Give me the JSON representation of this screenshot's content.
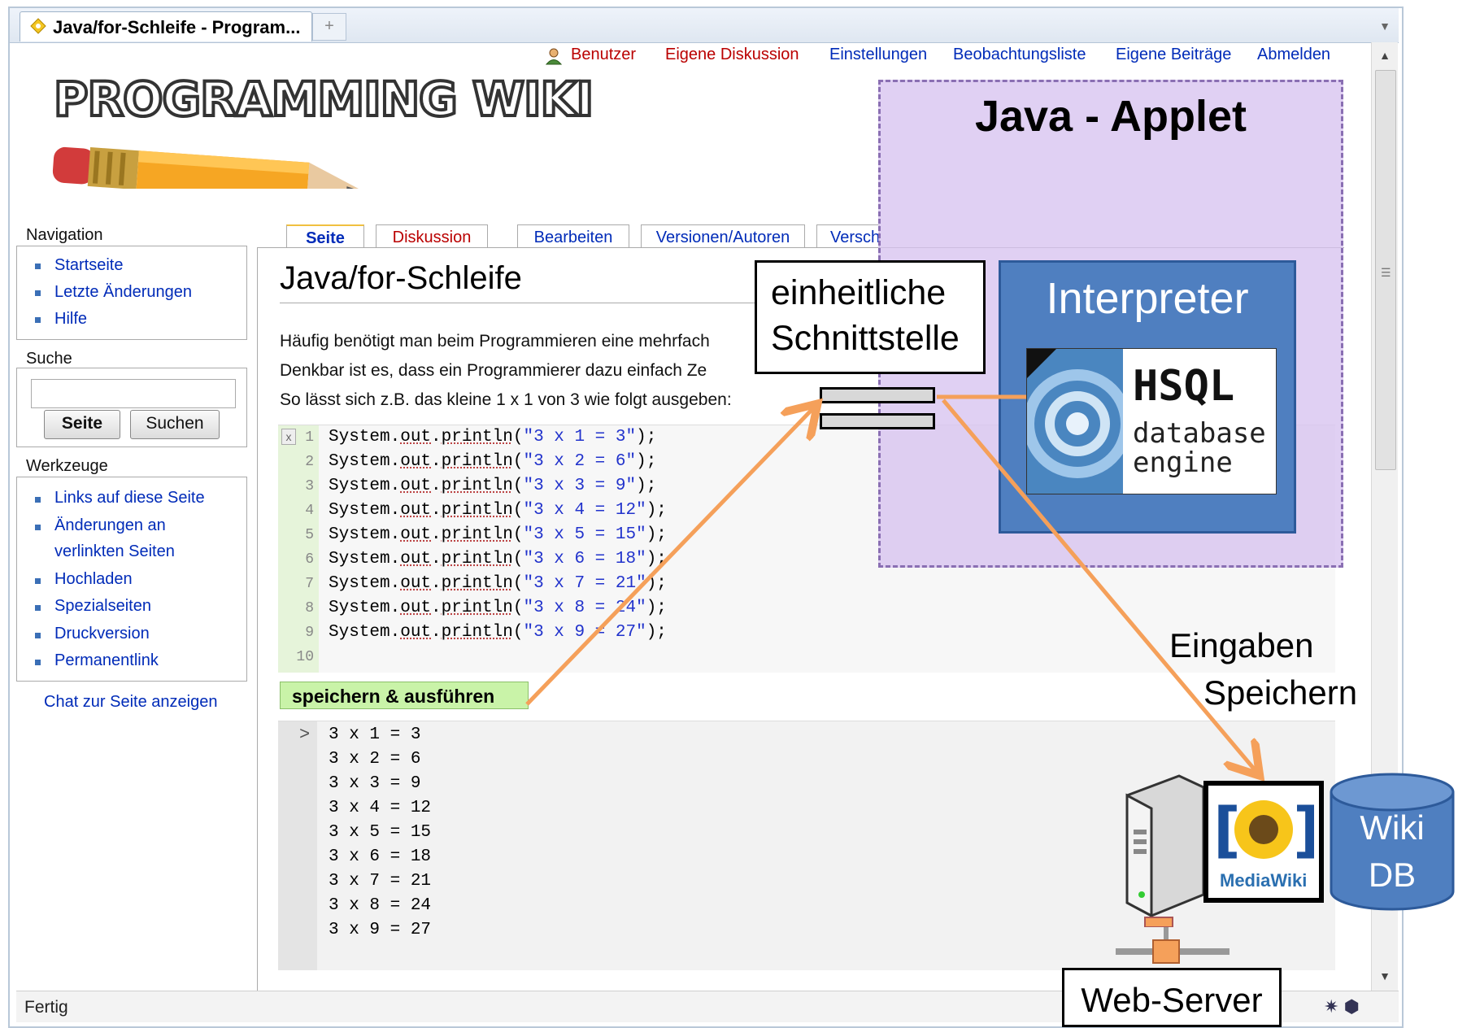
{
  "browser": {
    "tab_title": "Java/for-Schleife - Program...",
    "new_tab_icon": "plus-icon",
    "status_text": "Fertig"
  },
  "personal_links": {
    "user": "Benutzer",
    "own_discussion": "Eigene Diskussion",
    "settings": "Einstellungen",
    "watchlist": "Beobachtungsliste",
    "contributions": "Eigene Beiträge",
    "logout": "Abmelden"
  },
  "logo": {
    "text": "PROGRAMMING WIKI"
  },
  "navigation": {
    "heading": "Navigation",
    "items": [
      "Startseite",
      "Letzte Änderungen",
      "Hilfe"
    ]
  },
  "search": {
    "heading": "Suche",
    "value": "",
    "go_label": "Seite",
    "search_label": "Suchen"
  },
  "toolbox": {
    "heading": "Werkzeuge",
    "items": [
      "Links auf diese Seite",
      "Änderungen an",
      "verlinkten Seiten",
      "Hochladen",
      "Spezialseiten",
      "Druckversion",
      "Permanentlink"
    ],
    "chat_link": "Chat zur Seite anzeigen"
  },
  "content_tabs": [
    "Seite",
    "Diskussion",
    "Bearbeiten",
    "Versionen/Autoren",
    "Versch"
  ],
  "page": {
    "title": "Java/for-Schleife",
    "paragraphs": [
      "Häufig benötigt man beim Programmieren eine mehrfach",
      "Denkbar ist es, dass ein Programmierer dazu einfach Ze",
      "So lässt sich z.B. das kleine 1 x 1 von 3 wie folgt ausgeben:"
    ]
  },
  "editor": {
    "close_glyph": "x",
    "line_numbers": [
      "1",
      "2",
      "3",
      "4",
      "5",
      "6",
      "7",
      "8",
      "9",
      "10"
    ],
    "lines": [
      {
        "obj": "System.",
        "member": "out",
        "dot": ".",
        "fn": "println",
        "open": "(",
        "str": "\"3 x 1 = 3\"",
        "close": ");"
      },
      {
        "obj": "System.",
        "member": "out",
        "dot": ".",
        "fn": "println",
        "open": "(",
        "str": "\"3 x 2 = 6\"",
        "close": ");"
      },
      {
        "obj": "System.",
        "member": "out",
        "dot": ".",
        "fn": "println",
        "open": "(",
        "str": "\"3 x 3 = 9\"",
        "close": ");"
      },
      {
        "obj": "System.",
        "member": "out",
        "dot": ".",
        "fn": "println",
        "open": "(",
        "str": "\"3 x 4 = 12\"",
        "close": ");"
      },
      {
        "obj": "System.",
        "member": "out",
        "dot": ".",
        "fn": "println",
        "open": "(",
        "str": "\"3 x 5 = 15\"",
        "close": ");"
      },
      {
        "obj": "System.",
        "member": "out",
        "dot": ".",
        "fn": "println",
        "open": "(",
        "str": "\"3 x 6 = 18\"",
        "close": ");"
      },
      {
        "obj": "System.",
        "member": "out",
        "dot": ".",
        "fn": "println",
        "open": "(",
        "str": "\"3 x 7 = 21\"",
        "close": ");"
      },
      {
        "obj": "System.",
        "member": "out",
        "dot": ".",
        "fn": "println",
        "open": "(",
        "str": "\"3 x 8 = 24\"",
        "close": ");"
      },
      {
        "obj": "System.",
        "member": "out",
        "dot": ".",
        "fn": "println",
        "open": "(",
        "str": "\"3 x 9 = 27\"",
        "close": ");"
      }
    ]
  },
  "run_button": {
    "label": "speichern & ausführen"
  },
  "output": {
    "prompt": ">",
    "lines": [
      "3 x 1 = 3",
      "3 x 2 = 6",
      "3 x 3 = 9",
      "3 x 4 = 12",
      "3 x 5 = 15",
      "3 x 6 = 18",
      "3 x 7 = 21",
      "3 x 8 = 24",
      "3 x 9 = 27"
    ]
  },
  "diagram": {
    "applet_title": "Java - Applet",
    "interpreter_title": "Interpreter",
    "hsql_title": "HSQL",
    "hsql_sub1": "database",
    "hsql_sub2": "engine",
    "interface_line1": "einheitliche",
    "interface_line2": "Schnittstelle",
    "eingaben": "Eingaben",
    "speichern": "Speichern",
    "mediawiki": "MediaWiki",
    "db_line1": "Wiki",
    "db_line2": "DB",
    "webserver": "Web-Server",
    "arrow_color": "#f5a05a",
    "applet_color": "#d7c3f0",
    "interpreter_color": "#4f7fc0"
  },
  "colors": {
    "link": "#002bb8",
    "redlink": "#ba0000",
    "editor_gutter": "#e6f4da",
    "run_button": "#c9f3a8"
  }
}
